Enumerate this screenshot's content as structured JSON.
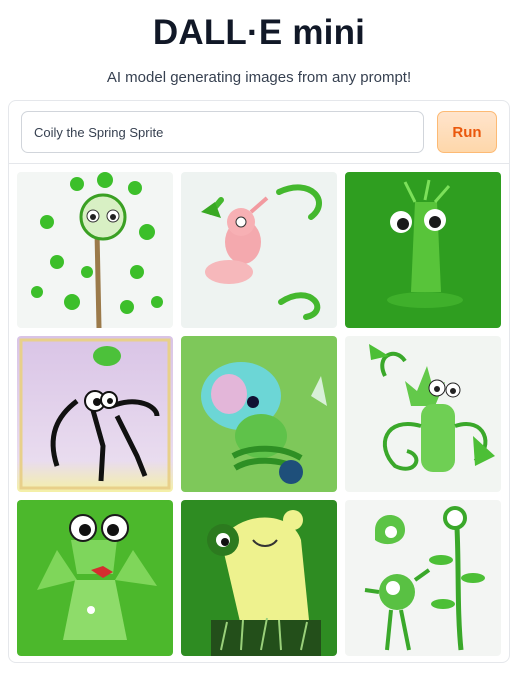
{
  "header": {
    "title": "DALL·E mini",
    "subtitle": "AI model generating images from any prompt!"
  },
  "prompt": {
    "value": "Coily the Spring Sprite"
  },
  "run_button": {
    "label": "Run"
  },
  "results": {
    "count": 9
  },
  "colors": {
    "accent": "#ea580c",
    "run_bg": "#fed7aa",
    "green": "#4caf26"
  }
}
